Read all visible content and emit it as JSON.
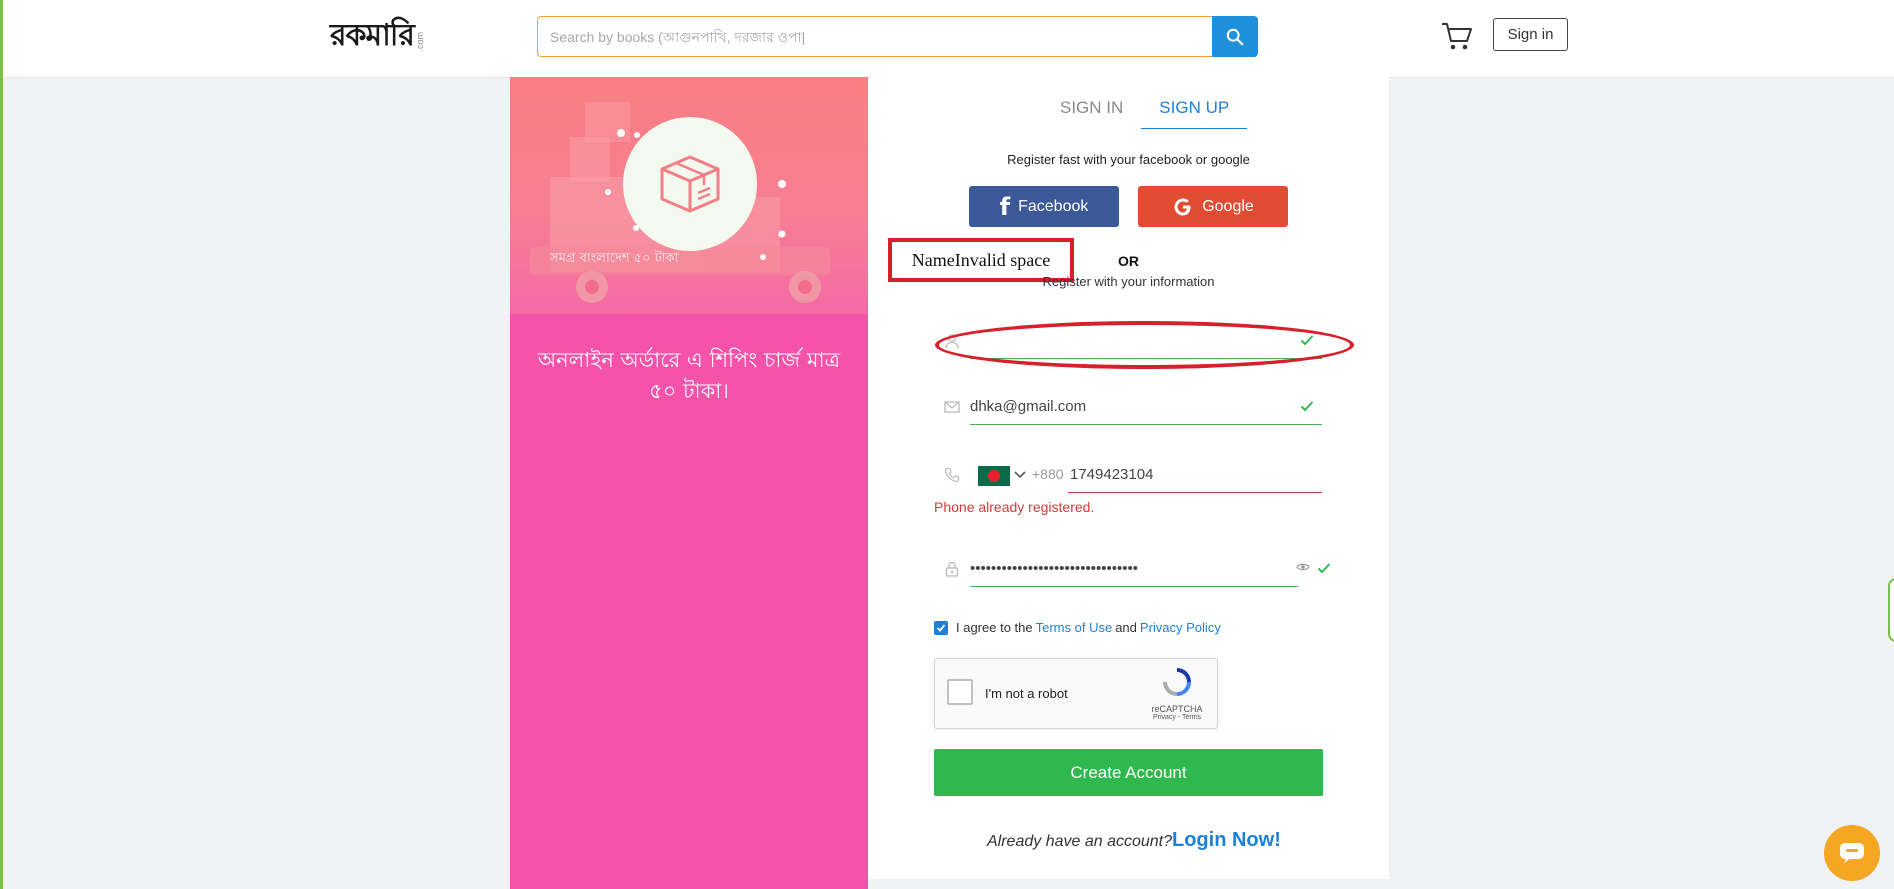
{
  "header": {
    "logo_text": "রকমারি",
    "logo_suffix": ".com",
    "search_placeholder": "Search by books (আগুনপাখি, দরজার ওপা|",
    "signin_label": "Sign in"
  },
  "promo": {
    "banner_text": "সমগ্র বাংলাদেশ ৫০ টাকা",
    "text": "অনলাইন অর্ডারে এ শিপিং চার্জ মাত্র ৫০ টাকা।"
  },
  "auth": {
    "tabs": [
      {
        "label": "SIGN IN",
        "active": false
      },
      {
        "label": "SIGN UP",
        "active": true
      }
    ],
    "register_fast": "Register fast with your facebook or google",
    "facebook_label": "Facebook",
    "google_label": "Google",
    "or_label": "OR",
    "register_info": "Register with your information"
  },
  "annotation": {
    "label": "NameInvalid space"
  },
  "form": {
    "name_value": "",
    "email_value": "dhka@gmail.com",
    "phone_code": "+880",
    "phone_value": "1749423104",
    "phone_error": "Phone already registered.",
    "password_value": "••••••••••••••••••••••••••••••••",
    "agree_prefix": "I agree to the",
    "terms_label": "Terms of Use",
    "and_label": "and",
    "privacy_label": "Privacy Policy",
    "recaptcha_label": "I'm not a robot",
    "recaptcha_brand": "reCAPTCHA",
    "recaptcha_links": "Privacy - Terms",
    "create_label": "Create Account",
    "already_label": "Already have an account?",
    "login_label": "Login Now!"
  },
  "colors": {
    "promo_pink": "#f553a9",
    "primary_blue": "#1e7fd8",
    "facebook": "#3b5998",
    "google": "#e04b32",
    "success_green": "#2fb84d",
    "error_red": "#d43a3a",
    "annotation_red": "#d8202a"
  },
  "icons": [
    "search-icon",
    "cart-icon",
    "user-icon",
    "mail-icon",
    "phone-icon",
    "lock-icon",
    "eye-icon",
    "check-icon",
    "chat-icon",
    "box-icon"
  ]
}
